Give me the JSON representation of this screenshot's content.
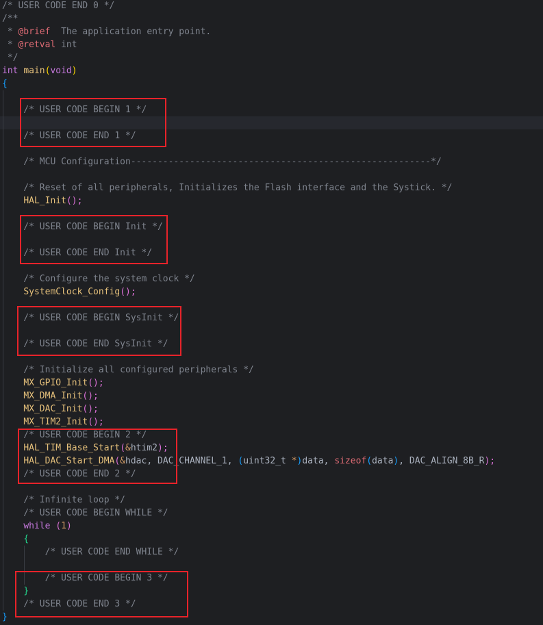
{
  "colors": {
    "background": "#1e1f22",
    "comment": "#7f848e",
    "keyword": "#c678dd",
    "function": "#e5c07b",
    "highlight_box": "#e8232a"
  },
  "lines": [
    {
      "tokens": [
        {
          "t": "/* USER CODE END 0 */",
          "c": "comment"
        }
      ]
    },
    {
      "tokens": [
        {
          "t": "/**",
          "c": "comment"
        }
      ]
    },
    {
      "tokens": [
        {
          "t": " * ",
          "c": "comment"
        },
        {
          "t": "@brief",
          "c": "tag"
        },
        {
          "t": "  The application entry point.",
          "c": "comment"
        }
      ]
    },
    {
      "tokens": [
        {
          "t": " * ",
          "c": "comment"
        },
        {
          "t": "@retval",
          "c": "tag"
        },
        {
          "t": " int",
          "c": "comment"
        }
      ]
    },
    {
      "tokens": [
        {
          "t": " */",
          "c": "comment"
        }
      ]
    },
    {
      "tokens": [
        {
          "t": "int",
          "c": "kw"
        },
        {
          "t": " ",
          "c": "plain"
        },
        {
          "t": "main",
          "c": "fn"
        },
        {
          "t": "(",
          "c": "paren-1"
        },
        {
          "t": "void",
          "c": "kw"
        },
        {
          "t": ")",
          "c": "paren-1"
        }
      ]
    },
    {
      "tokens": [
        {
          "t": "{",
          "c": "brace-open"
        }
      ]
    },
    {
      "tokens": []
    },
    {
      "tokens": [
        {
          "t": "    /* USER CODE BEGIN 1 */",
          "c": "comment"
        }
      ]
    },
    {
      "tokens": [],
      "current": true
    },
    {
      "tokens": [
        {
          "t": "    /* USER CODE END 1 */",
          "c": "comment"
        }
      ]
    },
    {
      "tokens": []
    },
    {
      "tokens": [
        {
          "t": "    /* MCU Configuration--------------------------------------------------------*/",
          "c": "comment"
        }
      ]
    },
    {
      "tokens": []
    },
    {
      "tokens": [
        {
          "t": "    /* Reset of all peripherals, Initializes the Flash interface and the Systick. */",
          "c": "comment"
        }
      ]
    },
    {
      "tokens": [
        {
          "t": "    ",
          "c": "plain"
        },
        {
          "t": "HAL_Init",
          "c": "fn"
        },
        {
          "t": "();",
          "c": "paren-2"
        }
      ]
    },
    {
      "tokens": []
    },
    {
      "tokens": [
        {
          "t": "    /* USER CODE BEGIN Init */",
          "c": "comment"
        }
      ]
    },
    {
      "tokens": []
    },
    {
      "tokens": [
        {
          "t": "    /* USER CODE END Init */",
          "c": "comment"
        }
      ]
    },
    {
      "tokens": []
    },
    {
      "tokens": [
        {
          "t": "    /* Configure the system clock */",
          "c": "comment"
        }
      ]
    },
    {
      "tokens": [
        {
          "t": "    ",
          "c": "plain"
        },
        {
          "t": "SystemClock_Config",
          "c": "fn"
        },
        {
          "t": "();",
          "c": "paren-2"
        }
      ]
    },
    {
      "tokens": []
    },
    {
      "tokens": [
        {
          "t": "    /* USER CODE BEGIN SysInit */",
          "c": "comment"
        }
      ]
    },
    {
      "tokens": []
    },
    {
      "tokens": [
        {
          "t": "    /* USER CODE END SysInit */",
          "c": "comment"
        }
      ]
    },
    {
      "tokens": []
    },
    {
      "tokens": [
        {
          "t": "    /* Initialize all configured peripherals */",
          "c": "comment"
        }
      ]
    },
    {
      "tokens": [
        {
          "t": "    ",
          "c": "plain"
        },
        {
          "t": "MX_GPIO_Init",
          "c": "fn"
        },
        {
          "t": "();",
          "c": "paren-2"
        }
      ]
    },
    {
      "tokens": [
        {
          "t": "    ",
          "c": "plain"
        },
        {
          "t": "MX_DMA_Init",
          "c": "fn"
        },
        {
          "t": "();",
          "c": "paren-2"
        }
      ]
    },
    {
      "tokens": [
        {
          "t": "    ",
          "c": "plain"
        },
        {
          "t": "MX_DAC_Init",
          "c": "fn"
        },
        {
          "t": "();",
          "c": "paren-2"
        }
      ]
    },
    {
      "tokens": [
        {
          "t": "    ",
          "c": "plain"
        },
        {
          "t": "MX_TIM2_Init",
          "c": "fn"
        },
        {
          "t": "();",
          "c": "paren-2"
        }
      ]
    },
    {
      "tokens": [
        {
          "t": "    /* USER CODE BEGIN 2 */",
          "c": "comment"
        }
      ]
    },
    {
      "tokens": [
        {
          "t": "    ",
          "c": "plain"
        },
        {
          "t": "HAL_TIM_Base_Start",
          "c": "fn"
        },
        {
          "t": "(",
          "c": "paren-2"
        },
        {
          "t": "&",
          "c": "macro"
        },
        {
          "t": "htim2",
          "c": "plain"
        },
        {
          "t": ");",
          "c": "paren-2"
        }
      ]
    },
    {
      "tokens": [
        {
          "t": "    ",
          "c": "plain"
        },
        {
          "t": "HAL_DAC_Start_DMA",
          "c": "fn"
        },
        {
          "t": "(",
          "c": "paren-2"
        },
        {
          "t": "&",
          "c": "macro"
        },
        {
          "t": "hdac, DAC_CHANNEL_1, ",
          "c": "plain"
        },
        {
          "t": "(",
          "c": "paren-3"
        },
        {
          "t": "uint32_t ",
          "c": "plain"
        },
        {
          "t": "*",
          "c": "macro"
        },
        {
          "t": ")",
          "c": "paren-3"
        },
        {
          "t": "data, ",
          "c": "plain"
        },
        {
          "t": "sizeof",
          "c": "var"
        },
        {
          "t": "(",
          "c": "paren-3"
        },
        {
          "t": "data",
          "c": "plain"
        },
        {
          "t": ")",
          "c": "paren-3"
        },
        {
          "t": ", DAC_ALIGN_8B_R",
          "c": "plain"
        },
        {
          "t": ");",
          "c": "paren-2"
        }
      ]
    },
    {
      "tokens": [
        {
          "t": "    /* USER CODE END 2 */",
          "c": "comment"
        }
      ]
    },
    {
      "tokens": []
    },
    {
      "tokens": [
        {
          "t": "    /* Infinite loop */",
          "c": "comment"
        }
      ]
    },
    {
      "tokens": [
        {
          "t": "    /* USER CODE BEGIN WHILE */",
          "c": "comment"
        }
      ]
    },
    {
      "tokens": [
        {
          "t": "    ",
          "c": "plain"
        },
        {
          "t": "while",
          "c": "kw"
        },
        {
          "t": " ",
          "c": "plain"
        },
        {
          "t": "(",
          "c": "paren-2"
        },
        {
          "t": "1",
          "c": "num"
        },
        {
          "t": ")",
          "c": "paren-2"
        }
      ]
    },
    {
      "tokens": [
        {
          "t": "    ",
          "c": "plain"
        },
        {
          "t": "{",
          "c": "brace-inner"
        }
      ]
    },
    {
      "tokens": [
        {
          "t": "        /* USER CODE END WHILE */",
          "c": "comment"
        }
      ]
    },
    {
      "tokens": []
    },
    {
      "tokens": [
        {
          "t": "        /* USER CODE BEGIN 3 */",
          "c": "comment"
        }
      ]
    },
    {
      "tokens": [
        {
          "t": "    ",
          "c": "plain"
        },
        {
          "t": "}",
          "c": "brace-inner"
        }
      ]
    },
    {
      "tokens": [
        {
          "t": "    /* USER CODE END 3 */",
          "c": "comment"
        }
      ]
    },
    {
      "tokens": [
        {
          "t": "}",
          "c": "brace-open"
        }
      ]
    }
  ],
  "highlight_regions": [
    {
      "name": "user-code-1"
    },
    {
      "name": "user-code-init"
    },
    {
      "name": "user-code-sysinit"
    },
    {
      "name": "user-code-2"
    },
    {
      "name": "user-code-3"
    }
  ]
}
